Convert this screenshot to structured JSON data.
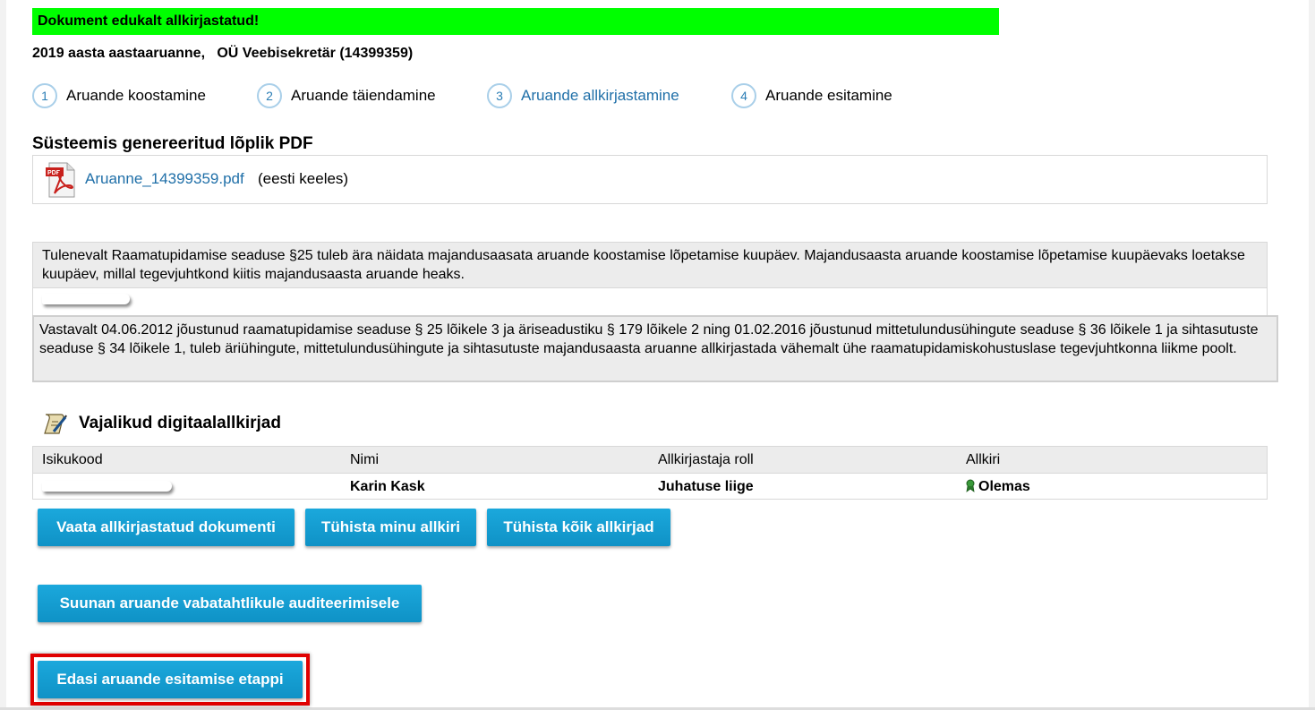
{
  "banner": {
    "text": "Dokument edukalt allkirjastatud!",
    "color": "#00ff00"
  },
  "report": {
    "title": "2019 aasta aastaaruanne,   OÜ Veebisekretär (14399359)"
  },
  "steps": [
    {
      "number": "1",
      "label": "Aruande koostamine",
      "active": false
    },
    {
      "number": "2",
      "label": "Aruande täiendamine",
      "active": false
    },
    {
      "number": "3",
      "label": "Aruande allkirjastamine",
      "active": true
    },
    {
      "number": "4",
      "label": "Aruande esitamine",
      "active": false
    }
  ],
  "pdf_section": {
    "title": "Süsteemis genereeritud lõplik PDF",
    "file_name": "Aruanne_14399359.pdf",
    "language_note": "(eesti keeles)",
    "icon": "pdf-file-icon"
  },
  "notices": {
    "completion_date": "Tulenevalt Raamatupidamise seaduse §25 tuleb ära näidata majandusaasata aruande koostamise lõpetamise kuupäev. Majandusaasta aruande koostamise lõpetamise kuupäevaks loetakse kuupäev, millal tegevjuhtkond kiitis majandusaasta aruande heaks.",
    "signing_requirement": "Vastavalt 04.06.2012 jõustunud raamatupidamise seaduse § 25 lõikele 3 ja äriseadustiku § 179 lõikele 2 ning 01.02.2016 jõustunud mittetulundusühingute seaduse § 36 lõikele 1 ja sihtasutuste seaduse § 34 lõikele 1, tuleb äriühingute, mittetulundusühingute ja sihtasutuste majandusaasta aruanne allkirjastada vähemalt ühe raamatupidamiskohustuslase tegevjuhtkonna liikme poolt."
  },
  "signatures": {
    "title": "Vajalikud digitaalallkirjad",
    "icon": "signature-scroll-icon",
    "columns": [
      "Isikukood",
      "Nimi",
      "Allkirjastaja roll",
      "Allkiri"
    ],
    "rows": [
      {
        "name": "Karin Kask",
        "role": "Juhatuse liige",
        "status": "Olemas",
        "status_icon": "signed-ribbon-icon"
      }
    ]
  },
  "buttons": {
    "view_signed": "Vaata allkirjastatud dokumenti",
    "cancel_mine": "Tühista minu allkiri",
    "cancel_all": "Tühista kõik allkirjad",
    "voluntary_audit": "Suunan aruande vabatahtlikule auditeerimisele",
    "next_stage": "Edasi aruande esitamise etappi"
  },
  "colors": {
    "button": "#1199d1",
    "link": "#1f6fa8",
    "highlight": "#e00000"
  }
}
